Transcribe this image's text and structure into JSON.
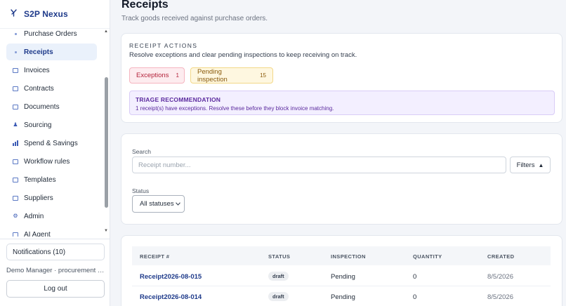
{
  "brand": {
    "logo_icon": "branch-icon",
    "name": "S2P Nexus"
  },
  "sidebar": {
    "items": [
      {
        "label": "Purchase Orders",
        "icon": "dot-icon",
        "active": false
      },
      {
        "label": "Receipts",
        "icon": "dot-icon",
        "active": true
      },
      {
        "label": "Invoices",
        "icon": "folder-icon",
        "active": false
      },
      {
        "label": "Contracts",
        "icon": "edit-icon",
        "active": false
      },
      {
        "label": "Documents",
        "icon": "folder-icon",
        "active": false
      },
      {
        "label": "Sourcing",
        "icon": "people-icon",
        "active": false
      },
      {
        "label": "Spend & Savings",
        "icon": "bar-chart-icon",
        "active": false
      },
      {
        "label": "Workflow rules",
        "icon": "flow-icon",
        "active": false
      },
      {
        "label": "Templates",
        "icon": "folder-icon",
        "active": false
      },
      {
        "label": "Suppliers",
        "icon": "building-icon",
        "active": false
      },
      {
        "label": "Admin",
        "icon": "gear-icon",
        "active": false
      },
      {
        "label": "AI Agent",
        "icon": "robot-icon",
        "active": false
      }
    ],
    "notifications_label": "Notifications (10)",
    "user_line": "Demo Manager · procurement m...",
    "logout_label": "Log out"
  },
  "page": {
    "title": "Receipts",
    "subtitle": "Track goods received against purchase orders."
  },
  "receipt_actions": {
    "kicker": "RECEIPT ACTIONS",
    "description": "Resolve exceptions and clear pending inspections to keep receiving on track.",
    "exceptions": {
      "label": "Exceptions",
      "count": "1",
      "color": "#b4233b"
    },
    "pending": {
      "label": "Pending inspection",
      "count": "15",
      "color": "#8a5a0b"
    },
    "triage": {
      "title": "TRIAGE RECOMMENDATION",
      "text": "1 receipt(s) have exceptions. Resolve these before they block invoice matching."
    }
  },
  "filters": {
    "search_label": "Search",
    "search_placeholder": "Receipt number...",
    "search_value": "",
    "filters_button": "Filters",
    "filters_icon": "▲",
    "status_label": "Status",
    "status_selected": "All statuses"
  },
  "table": {
    "columns": [
      "RECEIPT #",
      "STATUS",
      "INSPECTION",
      "QUANTITY",
      "CREATED"
    ],
    "rows": [
      {
        "receipt": "Receipt2026-08-015",
        "status": "draft",
        "inspection": "Pending",
        "quantity": "0",
        "created": "8/5/2026"
      },
      {
        "receipt": "Receipt2026-08-014",
        "status": "draft",
        "inspection": "Pending",
        "quantity": "0",
        "created": "8/5/2026"
      }
    ]
  },
  "colors": {
    "accent": "#1e3a8a",
    "active_bg": "#eaf1fb",
    "triage_bg": "#f3efff"
  }
}
